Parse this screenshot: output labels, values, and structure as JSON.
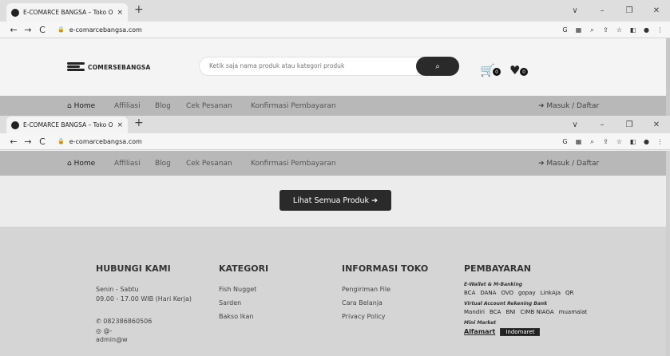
{
  "browser": {
    "tab_title": "E-COMARCE BANGSA – Toko On",
    "url": "e-comarcebangsa.com",
    "new_tab": "+",
    "tab_close": "×",
    "win_controls": [
      "∨",
      "–",
      "❐",
      "✕"
    ],
    "nav": [
      "←",
      "→",
      "C"
    ],
    "addr_icons": [
      "G",
      "▦",
      "⌕",
      "⇪",
      "☆",
      "◧",
      "●",
      "⋮"
    ]
  },
  "header": {
    "logo_text": "COMERSEBANGSA",
    "search_placeholder": "Ketik saja nama produk atau kategori produk",
    "search_icon": "🔍",
    "cart_count": "0",
    "wish_count": "0"
  },
  "nav": {
    "home": "Home",
    "items": [
      "Affiliasi",
      "Blog",
      "Cek Pesanan",
      "Konfirmasi Pembayaran"
    ],
    "login": "Masuk / Daftar"
  },
  "main": {
    "all_products_button": "Lihat Semua Produk"
  },
  "footer": {
    "contact": {
      "title": "HUBUNGI KAMI",
      "days": "Senin - Sabtu",
      "hours": "09.00 - 17.00 WIB (Hari Kerja)",
      "phone": "082386860506",
      "instagram": "@-",
      "email": "admin@w"
    },
    "categories": {
      "title": "KATEGORI",
      "items": [
        "Fish Nugget",
        "Sarden",
        "Bakso Ikan"
      ]
    },
    "info": {
      "title": "INFORMASI TOKO",
      "items": [
        "Pengiriman File",
        "Cara Belanja",
        "Privacy Policy"
      ]
    },
    "payment": {
      "title": "PEMBAYARAN",
      "ewallet_label": "E-Wallet & M-Banking",
      "ewallet": [
        "BCA",
        "DANA",
        "OVO",
        "gopay",
        "LinkAja",
        "QR"
      ],
      "va_label": "Virtual Account Rekening Bank",
      "va": [
        "Mandiri",
        "BCA",
        "BNI",
        "CIMB NIAGA",
        "muamalat"
      ],
      "mini_label": "Mini Market",
      "mini": [
        "Alfamart",
        "Indomaret"
      ]
    }
  }
}
